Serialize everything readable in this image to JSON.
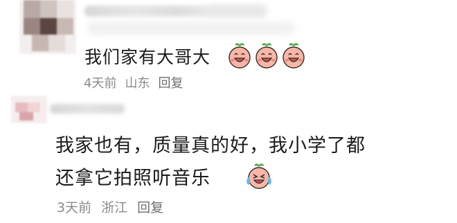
{
  "comments": [
    {
      "text": "我们家有大哥大",
      "emoji_icons": [
        "peach-face-laughing-icon",
        "peach-face-laughing-icon",
        "peach-face-laughing-icon"
      ],
      "time": "4天前",
      "location": "山东",
      "reply_label": "回复"
    },
    {
      "text_line1": "我家也有，质量真的好，我小学了都",
      "text_line2": "还拿它拍照听音乐",
      "emoji_icons": [
        "peach-face-tears-of-joy-icon"
      ],
      "time": "3天前",
      "location": "浙江",
      "reply_label": "回复"
    }
  ],
  "colors": {
    "background": "#ffffff",
    "text": "#1a1a1a",
    "meta": "#8a8a8a",
    "emoji_peach": "#f6b6a8",
    "emoji_leaf": "#5aa84a"
  }
}
